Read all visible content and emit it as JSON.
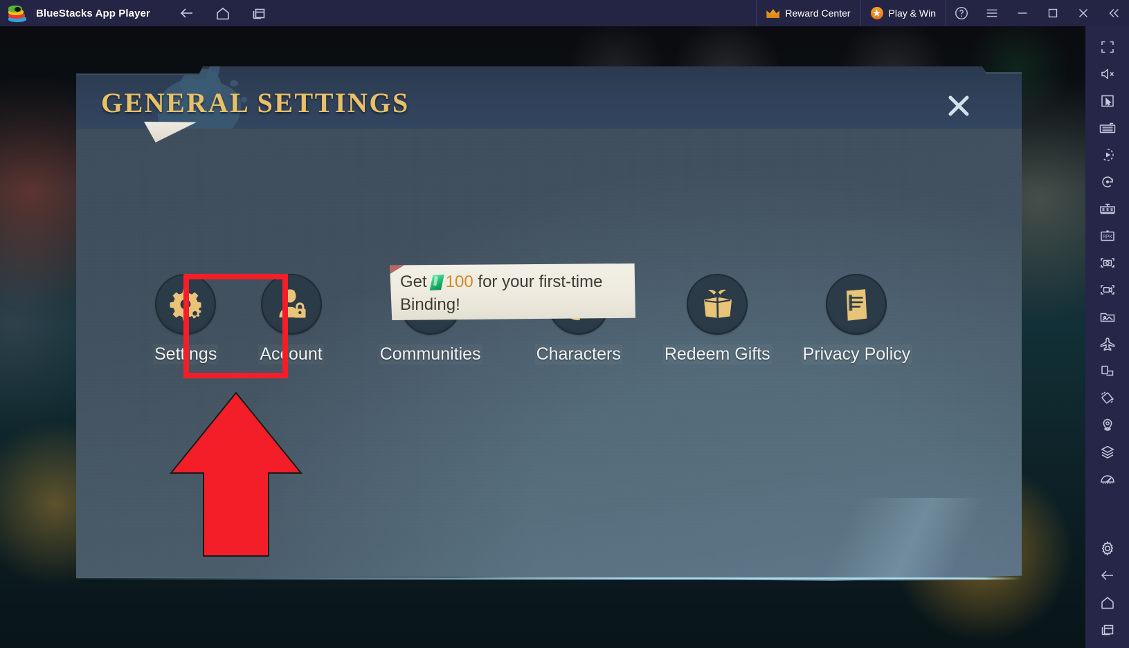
{
  "titlebar": {
    "app_title": "BlueStacks App Player",
    "logo_icon": "bluestacks-logo",
    "nav": [
      {
        "icon": "back-arrow-icon",
        "name": "back-button"
      },
      {
        "icon": "home-icon",
        "name": "home-button"
      },
      {
        "icon": "multi-instance-icon",
        "name": "multi-instance-button"
      }
    ],
    "reward_center_label": "Reward Center",
    "reward_center_icon": "crown-icon",
    "play_and_win_label": "Play & Win",
    "play_and_win_icon": "star-badge-icon",
    "help_icon": "help-circle-icon",
    "menu_icon": "hamburger-menu-icon",
    "minimize_icon": "minimize-icon",
    "maximize_icon": "maximize-icon",
    "close_icon": "close-icon",
    "collapse_icon": "double-chevron-left-icon"
  },
  "panel": {
    "title": "GENERAL SETTINGS",
    "close_icon": "close-x-icon",
    "accent_color": "#e8c06a",
    "background_color": "#44525f"
  },
  "tooltip": {
    "prefix": "Get",
    "gem_icon": "green-gem-icon",
    "count": "100",
    "suffix": "for your first-time Binding!"
  },
  "menu": {
    "items": [
      {
        "label": "Settings",
        "icon": "gear-icon",
        "highlighted": true
      },
      {
        "label": "Account",
        "icon": "account-lock-icon",
        "highlighted": false
      },
      {
        "label": "Communities",
        "icon": "two-people-icon",
        "highlighted": false
      },
      {
        "label": "Characters",
        "icon": "character-swap-icon",
        "highlighted": false
      },
      {
        "label": "Redeem Gifts",
        "icon": "gift-icon",
        "highlighted": false
      },
      {
        "label": "Privacy Policy",
        "icon": "document-icon",
        "highlighted": false
      }
    ]
  },
  "annotation": {
    "highlight_color": "#f41e28",
    "arrow_icon": "red-up-arrow",
    "box_target": "Settings"
  },
  "sidebar": {
    "items": [
      {
        "icon": "fullscreen-icon",
        "name": "sidebar-fullscreen"
      },
      {
        "icon": "mute-icon",
        "name": "sidebar-mute"
      },
      {
        "icon": "cursor-control-icon",
        "name": "sidebar-cursor-control"
      },
      {
        "icon": "keyboard-icon",
        "name": "sidebar-keymapping"
      },
      {
        "icon": "macro-play-icon",
        "name": "sidebar-macro"
      },
      {
        "icon": "rotate-icon",
        "name": "sidebar-rotate"
      },
      {
        "icon": "multi-instance-sync-icon",
        "name": "sidebar-sync"
      },
      {
        "icon": "rpk-install-icon",
        "name": "sidebar-install-apk"
      },
      {
        "icon": "screenshot-icon",
        "name": "sidebar-screenshot"
      },
      {
        "icon": "record-video-icon",
        "name": "sidebar-record"
      },
      {
        "icon": "media-manager-icon",
        "name": "sidebar-media-manager"
      },
      {
        "icon": "airplane-icon",
        "name": "sidebar-eco-mode"
      },
      {
        "icon": "rotate-screen-icon",
        "name": "sidebar-rotate-screen"
      },
      {
        "icon": "shake-icon",
        "name": "sidebar-shake"
      },
      {
        "icon": "location-pin-icon",
        "name": "sidebar-location"
      },
      {
        "icon": "layers-icon",
        "name": "sidebar-layers"
      },
      {
        "icon": "speedometer-icon",
        "name": "sidebar-performance"
      }
    ],
    "bottom_items": [
      {
        "icon": "gear-icon",
        "name": "sidebar-settings"
      },
      {
        "icon": "back-arrow-icon",
        "name": "sidebar-back"
      },
      {
        "icon": "home-icon",
        "name": "sidebar-home"
      },
      {
        "icon": "recent-apps-icon",
        "name": "sidebar-recent-apps"
      }
    ]
  }
}
